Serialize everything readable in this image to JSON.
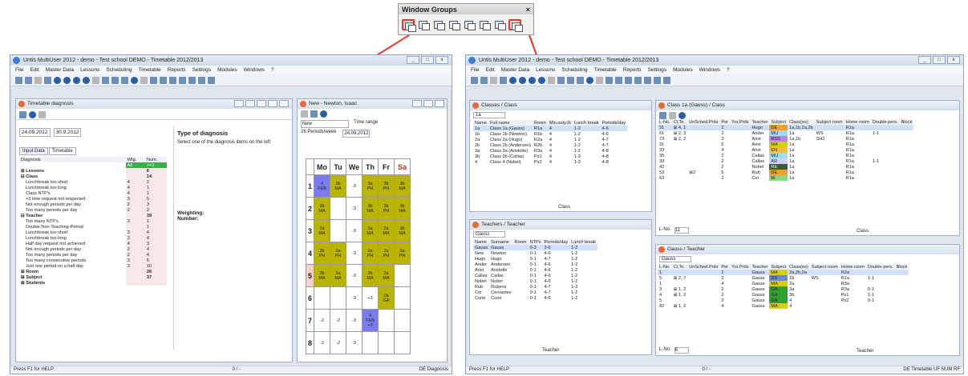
{
  "window_groups": {
    "title": "Window Groups",
    "close": "×"
  },
  "left": {
    "title": "Untis MultiUser 2012 - demo - Test school DEMO - Timetable 2012/2013",
    "menu": [
      "File",
      "Edit",
      "Master Data",
      "Lessons",
      "Scheduling",
      "Timetable",
      "Reports",
      "Settings",
      "Modules",
      "Windows",
      "?"
    ],
    "diag": {
      "title": "Timetable diagnosis",
      "date_from": "24.09.2012",
      "date_to": "30.9.2012",
      "tabs": [
        "Input Data",
        "Timetable"
      ],
      "col_diag": "Diagnosis",
      "col_wtg": "Wtg.",
      "col_num": "Num.",
      "all": "All",
      "all_num": ">=1",
      "rows": [
        [
          "⊞ Lessons",
          "",
          "6"
        ],
        [
          "⊟ Class",
          "",
          "14"
        ],
        [
          "Lunchbreak too short",
          "4",
          "2"
        ],
        [
          "Lunchbreak too long",
          "4",
          "1"
        ],
        [
          "Class NTP's",
          "4",
          "1"
        ],
        [
          "+3 time request not respected",
          "3",
          "5"
        ],
        [
          "Not enough periods per day",
          "2",
          "3"
        ],
        [
          "Too many periods per day",
          "2",
          "2"
        ],
        [
          "⊟ Teacher",
          "",
          "39"
        ],
        [
          "Too many NTP's",
          "3",
          "1"
        ],
        [
          "Double Non-Teaching-Period",
          "",
          "1"
        ],
        [
          "Lunchbreak too short",
          "3",
          "4"
        ],
        [
          "Lunchbreak too long",
          "3",
          "4"
        ],
        [
          "Half day request not achieved",
          "4",
          "3"
        ],
        [
          "Not enough periods per day",
          "2",
          "4"
        ],
        [
          "Too many periods per day",
          "2",
          "4"
        ],
        [
          "Too many consecutive periods",
          "3",
          "5"
        ],
        [
          "Just one period on a half day",
          "3",
          "10"
        ],
        [
          "⊞ Room",
          "",
          "26"
        ],
        [
          "⊞ Subject",
          "",
          "37"
        ],
        [
          "⊞ Students",
          "",
          ""
        ]
      ],
      "type_title": "Type of diagnosis",
      "type_text": "Select one of the diagnosis items on the left",
      "weighting": "Weighting:",
      "number": "Number:"
    },
    "tt": {
      "title": "New - Newton, Isaac",
      "name": "New",
      "range_label": "Time range",
      "range_date": "24.09.2012",
      "periods": "26 Periods/week",
      "days": [
        "Mo",
        "Tu",
        "We",
        "Th",
        "Fr",
        "Sa"
      ],
      "rows": [
        [
          "4\nFEB",
          "2b\nMA",
          "-3",
          "3a\nPH",
          "3b\nPH",
          "3b\nMA"
        ],
        [
          "2b\nMA",
          "",
          "-3",
          "3b\nMA",
          "2b\nPH",
          "3b\nMA"
        ],
        [
          "2a\nMA",
          "",
          "-3",
          "2a\nMA",
          "2a\nMA",
          "3b\nMA"
        ],
        [
          "3b\nPH",
          "2a\nPH",
          "-3",
          "2a\nPH",
          "2a\nPH",
          "3a\nPH"
        ],
        [
          "3b\nMA",
          "2a\nMA",
          "-3",
          "2b\nMA",
          "2a\nMA",
          ""
        ],
        [
          "",
          "",
          "-3",
          "+3",
          "2a\nGA",
          ""
        ],
        [
          "-2",
          "-2",
          "-3",
          "4\nFEB\n+3",
          "",
          ""
        ],
        [
          "-2",
          "-2",
          "-3",
          "",
          "",
          ""
        ]
      ]
    },
    "status": "Press F1 for HELP",
    "status_mid": "0 / -",
    "status_de": "DE",
    "status_right": "Diagnosis"
  },
  "right": {
    "title": "Untis MultiUser 2012 - demo - Test school DEMO - Timetable 2012/2013",
    "menu": [
      "File",
      "Edit",
      "Master Data",
      "Lessons",
      "Scheduling",
      "Timetable",
      "Reports",
      "Settings",
      "Modules",
      "Windows",
      "?"
    ],
    "classes": {
      "title": "Classes / Class",
      "sel": "1a",
      "cols": [
        "Name",
        "Full name",
        "Room",
        "Min.outy.Ib",
        "Lunch break",
        "Periods/day"
      ],
      "rows": [
        [
          "1a",
          "Class 1a (Gauss)",
          "R1a",
          "4",
          "1-2",
          "4-6"
        ],
        [
          "1b",
          "Class 1b (Newton)",
          "R1b",
          "4",
          "1-2",
          "4-6"
        ],
        [
          "2a",
          "Class 2a (Hugo)",
          "R2a",
          "4",
          "1-2",
          "4-7"
        ],
        [
          "2b",
          "Class 2b (Andersen)",
          "R2b",
          "4",
          "1-2",
          "4-7"
        ],
        [
          "3a",
          "Class 3a (Aristotle)",
          "R3a",
          "4",
          "1-2",
          "4-8"
        ],
        [
          "3b",
          "Class 3b (Callas)",
          "Ps1",
          "4",
          "1-3",
          "4-8"
        ],
        [
          "4",
          "Class 4 (Nobel)",
          "Ps2",
          "4",
          "1-3",
          "4-8"
        ]
      ],
      "footer": "Class"
    },
    "teachers": {
      "title": "Teachers / Teacher",
      "sel": "Gauss",
      "cols": [
        "Name",
        "Surname",
        "Room",
        "NTPs",
        "Periods/day",
        "Lunch break"
      ],
      "rows": [
        [
          "Gauss",
          "Gauss",
          "",
          "0-3",
          "2-6",
          "1-2"
        ],
        [
          "New",
          "Newton",
          "",
          "0-1",
          "4-6",
          "1-2"
        ],
        [
          "Hugo",
          "Hugo",
          "",
          "0-1",
          "4-7",
          "1-2"
        ],
        [
          "Ander",
          "Andersen",
          "",
          "0-1",
          "4-6",
          "1-2"
        ],
        [
          "Arist",
          "Aristotle",
          "",
          "0-1",
          "4-6",
          "1-2"
        ],
        [
          "Callas",
          "Callas",
          "",
          "0-1",
          "4-6",
          "1-2"
        ],
        [
          "Nobel",
          "Nobel",
          "",
          "0-1",
          "4-6",
          "1-2"
        ],
        [
          "Rub",
          "Rubens",
          "",
          "0-1",
          "4-7",
          "1-3"
        ],
        [
          "Cer",
          "Cervantes",
          "",
          "0-1",
          "4-7",
          "1-2"
        ],
        [
          "Curie",
          "Curie",
          "",
          "0-1",
          "4-6",
          "1-2"
        ]
      ],
      "footer": "Teacher"
    },
    "class1a": {
      "title": "Class 1a (Gauss) / Class",
      "cols": [
        "L-No.",
        "Cl,Te.",
        "UnSched.Prds",
        "Per",
        "Yrs.Prds",
        "Teacher",
        "Subject",
        "Class(es)",
        "Subject room",
        "Home room",
        "Double pers.",
        "Block"
      ],
      "rows": [
        [
          "31",
          "⊞ 4, 1",
          "",
          "2",
          "",
          "Hugo",
          "DE",
          "1a,1b,2a,2b",
          "",
          "R1a",
          "",
          ""
        ],
        [
          "61",
          "⊞ 2, 3",
          "",
          "2",
          "",
          "Ander",
          "MU",
          "1a",
          "WS",
          "R1a",
          "1-1",
          ""
        ],
        [
          "73",
          "⊞ 2, 2",
          "",
          "3",
          "",
          "Arist",
          "RSS",
          "1a,1b",
          "SH2",
          "R1a",
          "",
          ""
        ],
        [
          "31",
          "",
          "",
          "5",
          "",
          "Arist",
          "MA",
          "1a",
          "",
          "R1a",
          "",
          ""
        ],
        [
          "33",
          "",
          "",
          "4",
          "",
          "Arist",
          "EN",
          "1a",
          "",
          "R1a",
          "",
          ""
        ],
        [
          "35",
          "",
          "",
          "2",
          "",
          "Callas",
          "MU",
          "1a",
          "",
          "R1a",
          "",
          ""
        ],
        [
          "39",
          "",
          "",
          "2",
          "",
          "Callas",
          "AR",
          "1a",
          "",
          "R1a",
          "1-1",
          ""
        ],
        [
          "42",
          "",
          "",
          "2",
          "",
          "Nobel",
          "RE",
          "1a",
          "",
          "R1a",
          "",
          ""
        ],
        [
          "53",
          "",
          "⊞2",
          "5",
          "",
          "Rub",
          "DE",
          "1a",
          "",
          "R1a",
          "",
          ""
        ],
        [
          "63",
          "",
          "",
          "2",
          "",
          "Cer",
          "BI",
          "1a",
          "",
          "R1a",
          "",
          ""
        ]
      ],
      "lno": "11",
      "footer": "Class"
    },
    "gauss": {
      "title": "Gauss / Teacher",
      "sel": "Gauss",
      "cols": [
        "L-No.",
        "Cl,Te.",
        "UnSched.Prds",
        "Per",
        "Yrs.Prds",
        "Teacher",
        "Subject",
        "Class(es)",
        "Subject room",
        "Home room",
        "Double pers.",
        "Block"
      ],
      "rows": [
        [
          "1",
          "",
          "",
          "1",
          "",
          "Gauss",
          "MA",
          "2a,2b,2a",
          "",
          "R2a",
          "",
          ""
        ],
        [
          "5",
          "⊞ 2, 7",
          "",
          "2",
          "",
          "Gauss",
          "DS",
          "1b",
          "WS",
          "R1a",
          "1-1",
          ""
        ],
        [
          "1",
          "",
          "",
          "4",
          "",
          "Gauss",
          "MA",
          "2a",
          "",
          "R3a",
          "",
          ""
        ],
        [
          "3",
          "⊞ 1, 2",
          "",
          "2",
          "",
          "Gauss",
          "GA",
          "3a",
          "",
          "R3a",
          "0-1",
          ""
        ],
        [
          "4",
          "⊞ 1, 2",
          "",
          "2",
          "",
          "Gauss",
          "GA",
          "3b",
          "",
          "Ps1",
          "1-1",
          ""
        ],
        [
          "5",
          "",
          "",
          "2",
          "",
          "Gauss",
          "GA",
          "4",
          "",
          "Ps2",
          "0-1",
          ""
        ],
        [
          "82",
          "⊞ 1, 2",
          "",
          "4",
          "",
          "Gauss",
          "MA",
          "4",
          "",
          "",
          "",
          ""
        ]
      ],
      "lno": "6",
      "footer": "Teacher"
    },
    "status": "Press F1 for HELP",
    "status_mid": "0 / -",
    "status_de": "DE",
    "status_right": "Timetable",
    "status_caps": "UF NUM RF"
  }
}
